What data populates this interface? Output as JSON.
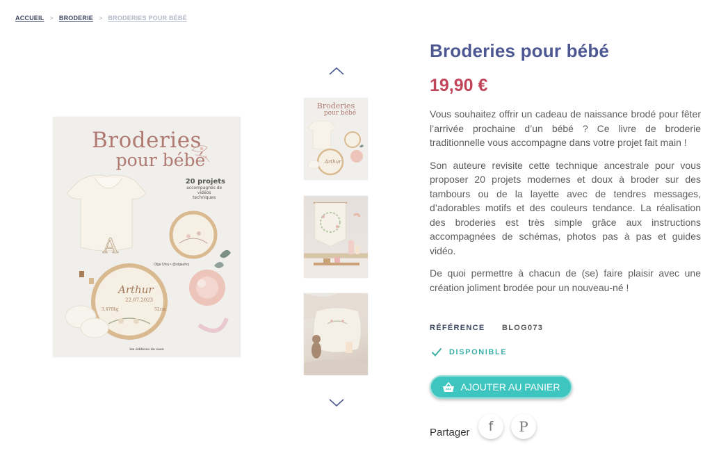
{
  "breadcrumb": {
    "home": "ACCUEIL",
    "category": "BRODERIE",
    "current": "BRODERIES POUR BÉBÉ",
    "separator": ">"
  },
  "gallery": {
    "cover": {
      "title_line1": "Broderies",
      "title_line2": "pour bébé",
      "badge_big": "20 projets",
      "badge_small": "accompagnés de vidéos techniques",
      "author": "Olga Uhry • @olgauhry",
      "hoop_name": "Arthur",
      "hoop_date": "22.07.2023",
      "hoop_weight": "3,470kg",
      "hoop_size": "52cm",
      "publisher": "les éditions de saxe"
    },
    "thumbnails": [
      {
        "alt": "Couverture du livre"
      },
      {
        "alt": "Bannière brodée"
      },
      {
        "alt": "Coussin brodé"
      }
    ]
  },
  "product": {
    "title": "Broderies pour bébé",
    "price": "19,90 €",
    "description": [
      "Vous souhaitez offrir un cadeau de naissance brodé pour fêter l’arrivée prochaine d’un bébé ? Ce livre de broderie traditionnelle vous accompagne dans votre projet fait main !",
      "Son auteure revisite cette technique ancestrale pour vous proposer 20 projets modernes et doux à broder sur des tambours ou de la layette avec de tendres messages, d’adorables motifs et des couleurs tendance. La réalisation des broderies est très simple grâce aux instructions accompagnées de schémas, photos pas à pas et guides vidéo.",
      "De quoi permettre à chacun de (se) faire plaisir avec une création joliment brodée pour un nouveau-né !"
    ],
    "reference_label": "RÉFÉRENCE",
    "reference_value": "BLOG073",
    "availability": "DISPONIBLE",
    "add_to_cart": "AJOUTER AU PANIER",
    "share_label": "Partager"
  },
  "colors": {
    "title": "#4d5791",
    "price": "#c0455a",
    "accent": "#3ec5bf",
    "available": "#3ab0a7"
  },
  "icons": {
    "thumb_up": "chevron-up-icon",
    "thumb_down": "chevron-down-icon",
    "available": "check-icon",
    "cart": "basket-icon",
    "share_fb": "facebook-icon",
    "share_pin": "pinterest-icon"
  }
}
